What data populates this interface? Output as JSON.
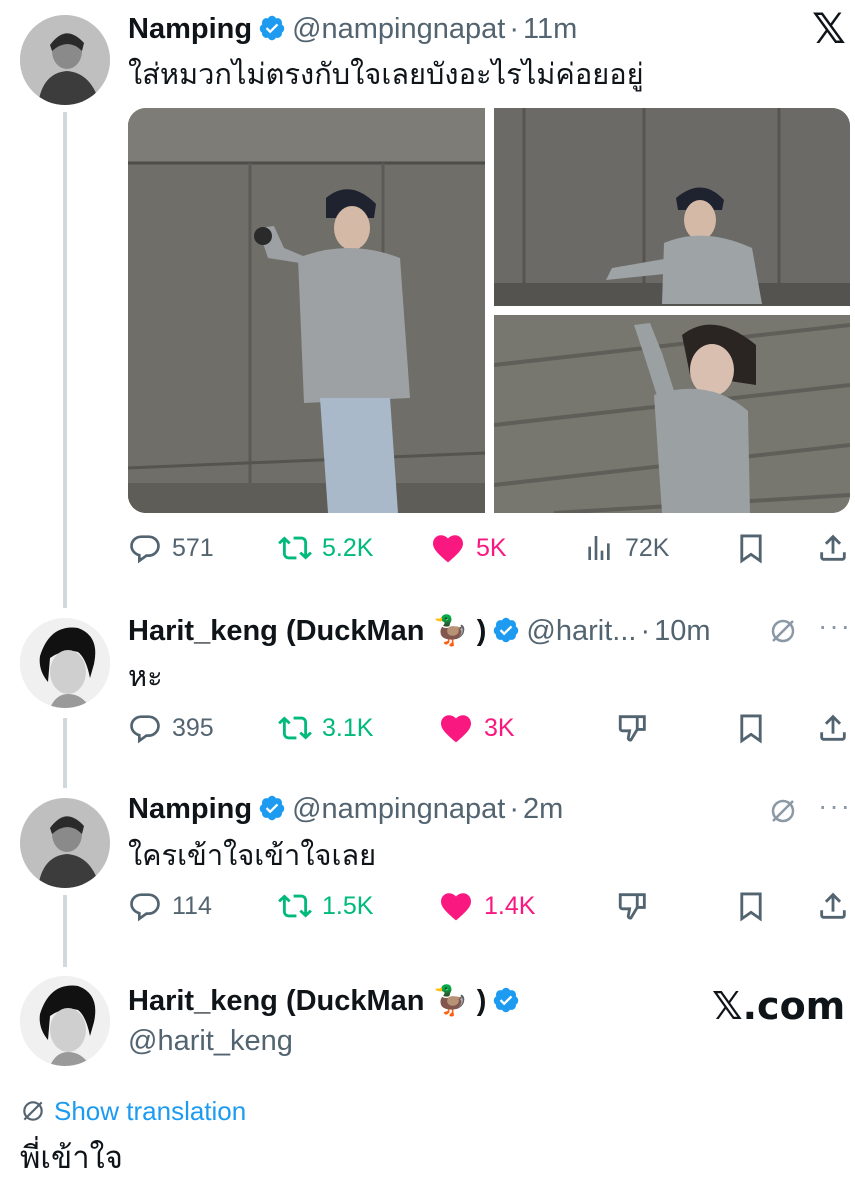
{
  "tweets": [
    {
      "name": "Namping",
      "handle": "@nampingnapat",
      "sep": "·",
      "time": "11m",
      "text": "ใส่หมวกไม่ตรงกับใจเลยบังอะไรไม่ค่อยอยู่",
      "replies": "571",
      "retweets": "5.2K",
      "likes": "5K",
      "views": "72K"
    },
    {
      "name": "Harit_keng (DuckMan 🦆 )",
      "handle": "@harit...",
      "sep": "·",
      "time": "10m",
      "text": "หะ",
      "replies": "395",
      "retweets": "3.1K",
      "likes": "3K"
    },
    {
      "name": "Namping",
      "handle": "@nampingnapat",
      "sep": "·",
      "time": "2m",
      "text": "ใครเข้าใจเข้าใจเลย",
      "replies": "114",
      "retweets": "1.5K",
      "likes": "1.4K"
    }
  ],
  "last": {
    "name": "Harit_keng (DuckMan 🦆 )",
    "handle": "@harit_keng",
    "watermark": "𝕏.com",
    "show_translation": "Show translation",
    "text": "พี่เข้าใจ"
  },
  "brand": {
    "logo": "𝕏"
  },
  "colors": {
    "accent": "#1d9bf0",
    "retweet": "#00ba7c",
    "like": "#f91880",
    "muted": "#536471"
  },
  "icons": [
    "x-logo-icon",
    "verified-badge-icon",
    "reply-icon",
    "retweet-icon",
    "heart-icon",
    "views-icon",
    "bookmark-icon",
    "share-icon",
    "dislike-icon",
    "translate-icon",
    "more-icon"
  ]
}
